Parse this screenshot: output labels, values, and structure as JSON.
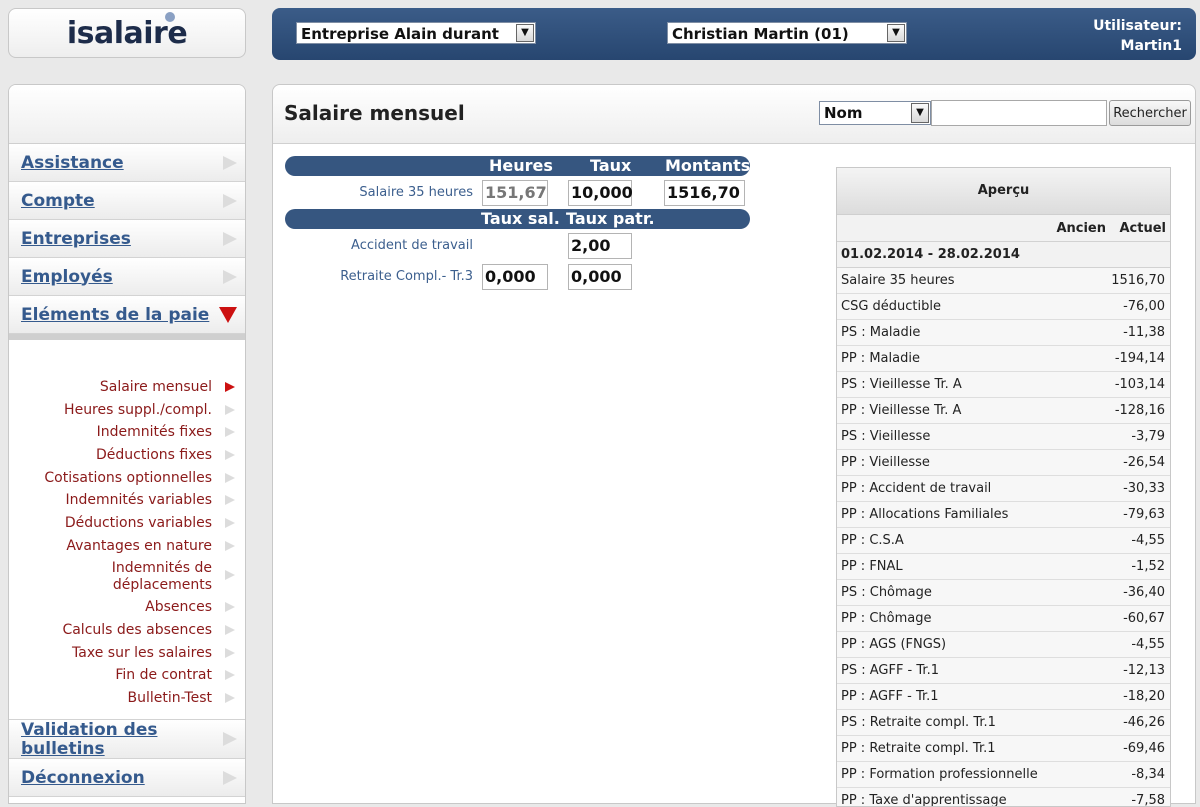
{
  "logo": {
    "text": "isalaire"
  },
  "topbar": {
    "company_select": "Entreprise Alain durant",
    "employee_select": "Christian Martin (01)",
    "user_label": "Utilisateur:",
    "user_name": "Martin1"
  },
  "sidebar": {
    "items": [
      {
        "label": "Assistance"
      },
      {
        "label": "Compte"
      },
      {
        "label": "Entreprises"
      },
      {
        "label": "Employés"
      },
      {
        "label": "Eléments de la paie"
      }
    ],
    "subitems": [
      {
        "label": "Salaire mensuel"
      },
      {
        "label": "Heures suppl./compl."
      },
      {
        "label": "Indemnités fixes"
      },
      {
        "label": "Déductions fixes"
      },
      {
        "label": "Cotisations optionnelles"
      },
      {
        "label": "Indemnités variables"
      },
      {
        "label": "Déductions variables"
      },
      {
        "label": "Avantages en nature"
      },
      {
        "label_line1": "Indemnités de",
        "label_line2": "déplacements"
      },
      {
        "label": "Absences"
      },
      {
        "label": "Calculs des absences"
      },
      {
        "label": "Taxe sur les salaires"
      },
      {
        "label": "Fin de contrat"
      },
      {
        "label": "Bulletin-Test"
      }
    ],
    "bottom_items": [
      {
        "label_line1": "Validation des",
        "label_line2": "bulletins"
      },
      {
        "label": "Déconnexion"
      }
    ]
  },
  "main": {
    "title": "Salaire mensuel",
    "search": {
      "field_select": "Nom",
      "input_value": "",
      "button_label": "Rechercher"
    },
    "header1": {
      "heures": "Heures",
      "taux": "Taux",
      "montants": "Montants"
    },
    "salary_row": {
      "label": "Salaire 35 heures",
      "heures": "151,67",
      "taux": "10,000",
      "montant": "1516,70"
    },
    "header2": {
      "taux_sal": "Taux sal.",
      "taux_patr": "Taux patr."
    },
    "accident_row": {
      "label": "Accident de travail",
      "taux_patr": "2,00"
    },
    "retraite_row": {
      "label": "Retraite Compl.- Tr.3",
      "taux_sal": "0,000",
      "taux_patr": "0,000"
    }
  },
  "apercu": {
    "title": "Aperçu",
    "col_ancien": "Ancien",
    "col_actuel": "Actuel",
    "period": "01.02.2014 - 28.02.2014",
    "rows": [
      {
        "name": "Salaire 35 heures",
        "value": "1516,70"
      },
      {
        "name": "CSG déductible",
        "value": "-76,00"
      },
      {
        "name": "PS : Maladie",
        "value": "-11,38"
      },
      {
        "name": "PP : Maladie",
        "value": "-194,14"
      },
      {
        "name": "PS : Vieillesse Tr. A",
        "value": "-103,14"
      },
      {
        "name": "PP : Vieillesse Tr. A",
        "value": "-128,16"
      },
      {
        "name": "PS : Vieillesse",
        "value": "-3,79"
      },
      {
        "name": "PP : Vieillesse",
        "value": "-26,54"
      },
      {
        "name": "PP : Accident de travail",
        "value": "-30,33"
      },
      {
        "name": "PP : Allocations Familiales",
        "value": "-79,63"
      },
      {
        "name": "PP : C.S.A",
        "value": "-4,55"
      },
      {
        "name": "PP : FNAL",
        "value": "-1,52"
      },
      {
        "name": "PS : Chômage",
        "value": "-36,40"
      },
      {
        "name": "PP : Chômage",
        "value": "-60,67"
      },
      {
        "name": "PP : AGS (FNGS)",
        "value": "-4,55"
      },
      {
        "name": "PS : AGFF - Tr.1",
        "value": "-12,13"
      },
      {
        "name": "PP : AGFF - Tr.1",
        "value": "-18,20"
      },
      {
        "name": "PS : Retraite compl. Tr.1",
        "value": "-46,26"
      },
      {
        "name": "PP : Retraite compl. Tr.1",
        "value": "-69,46"
      },
      {
        "name": "PP : Formation professionnelle",
        "value": "-8,34"
      },
      {
        "name": "PP : Taxe d'apprentissage",
        "value": "-7,58"
      }
    ]
  }
}
